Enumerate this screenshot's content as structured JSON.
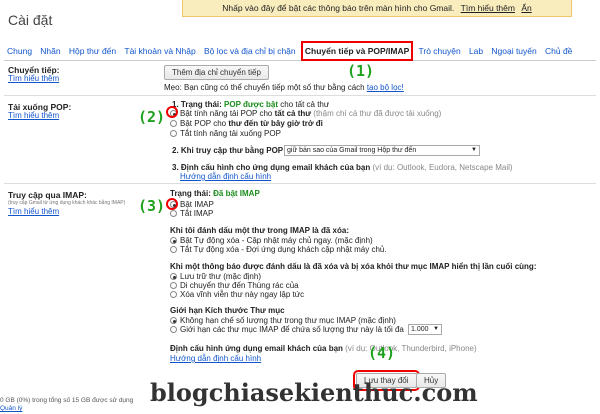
{
  "notification": {
    "text": "Nhấp vào đây để bật các thông báo trên màn hình cho Gmail.",
    "learn": "Tìm hiểu thêm",
    "hide": "Ẩn"
  },
  "title": "Cài đặt",
  "tabs": [
    "Chung",
    "Nhãn",
    "Hộp thư đến",
    "Tài khoản và Nhập",
    "Bộ lọc và địa chỉ bị chặn",
    "Chuyển tiếp và POP/IMAP",
    "Trò chuyện",
    "Lab",
    "Ngoại tuyến",
    "Chủ đề"
  ],
  "forwarding": {
    "label": "Chuyển tiếp:",
    "learn": "Tìm hiểu thêm",
    "button": "Thêm địa chỉ chuyển tiếp",
    "tip": "Mẹo: Bạn cũng có thể chuyển tiếp một số thư bằng cách",
    "tip_link": "tạo bộ lọc!"
  },
  "pop": {
    "label": "Tải xuống POP:",
    "learn": "Tìm hiểu thêm",
    "status_prefix": "1. Trạng thái:",
    "status": "POP được bật",
    "status_suffix": "cho tất cả thư",
    "opt1": "Bật tính năng tải POP cho",
    "opt1_bold": "tất cả thư",
    "opt1_gray": "(thậm chí cả thư đã được tải xuống)",
    "opt2": "Bật POP cho",
    "opt2_bold": "thư đến từ bây giờ trở đi",
    "opt3": "Tắt tính năng tải xuống POP",
    "q2": "2. Khi truy cập thư bằng POP",
    "q2_select": "giữ bản sao của Gmail trong Hộp thư đến",
    "q3": "3. Định cấu hình cho ứng dụng email khách của bạn",
    "q3_gray": "(ví dụ: Outlook, Eudora, Netscape Mail)",
    "q3_link": "Hướng dẫn định cấu hình"
  },
  "imap": {
    "label": "Truy cập qua IMAP:",
    "sublabel": "(truy cập Gmail từ ứng dụng khách khác bằng IMAP)",
    "learn": "Tìm hiểu thêm",
    "status_prefix": "Trạng thái:",
    "status": "Đã bật IMAP",
    "on": "Bật IMAP",
    "off": "Tắt IMAP",
    "del_title": "Khi tôi đánh dấu một thư trong IMAP là đã xóa:",
    "del1": "Bật Tự động xóa - Cập nhật máy chủ ngay. (mặc định)",
    "del2": "Tắt Tự động xóa - Đợi ứng dụng khách cập nhật máy chủ.",
    "exp_title": "Khi một thông báo được đánh dấu là đã xóa và bị xóa khỏi thư mục IMAP hiển thị lần cuối cùng:",
    "exp1": "Lưu trữ thư (mặc định)",
    "exp2": "Di chuyển thư đến Thùng rác của",
    "exp3": "Xóa vĩnh viễn thư này ngay lập tức",
    "lim_title": "Giới hạn Kích thước Thư mục",
    "lim1": "Không hạn chế số lượng thư trong thư mục IMAP (mặc định)",
    "lim2": "Giới hạn các thư mục IMAP để chứa số lượng thư này là tối đa",
    "lim_select": "1.000",
    "cfg": "Định cấu hình ứng dụng email khách của bạn",
    "cfg_gray": "(ví dụ: Outlook, Thunderbird, iPhone)",
    "cfg_link": "Hướng dẫn định cấu hình"
  },
  "actions": {
    "save": "Lưu thay đổi",
    "cancel": "Hủy"
  },
  "footer": {
    "usage": "0 GB (0%) trong tổng số 15 GB được sử dụng",
    "manage": "Quản lý"
  },
  "markers": {
    "m1": "(1)",
    "m2": "(2)",
    "m3": "(3)",
    "m4": "(4)"
  },
  "watermark": "blogchiasekienthuc.com",
  "colors": {
    "accent_link": "#1155cc",
    "enabled_status": "#1a8c1a",
    "highlight": "#e00000",
    "notif_bg": "#f9edbe"
  }
}
